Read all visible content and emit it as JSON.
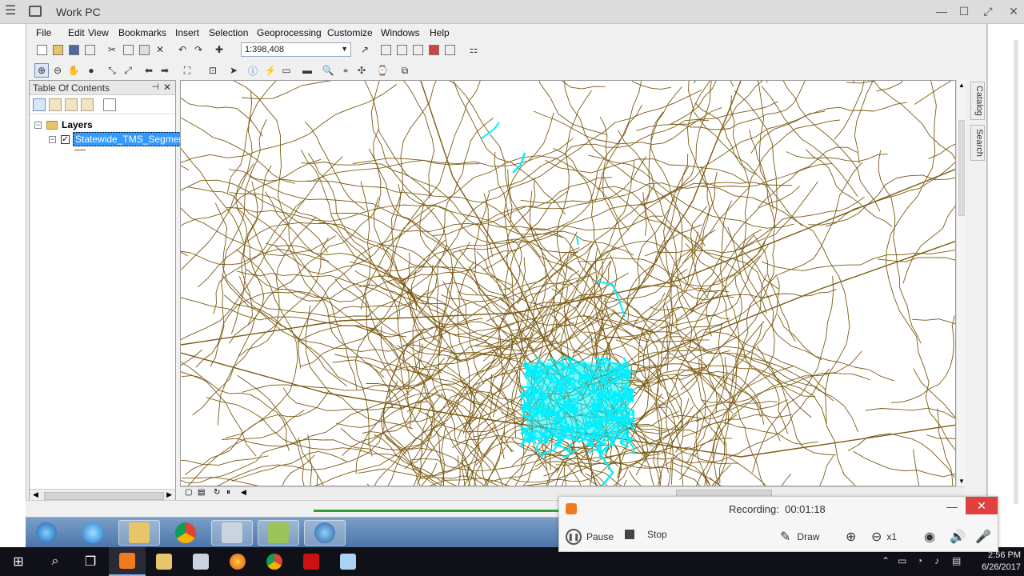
{
  "window": {
    "title": "Work PC"
  },
  "menu": [
    "File",
    "Edit",
    "View",
    "Bookmarks",
    "Insert",
    "Selection",
    "Geoprocessing",
    "Customize",
    "Windows",
    "Help"
  ],
  "toolbar": {
    "scale": "1:398,408"
  },
  "toc": {
    "title": "Table Of Contents",
    "root": "Layers",
    "layer": "Statewide_TMS_Segment"
  },
  "dock": {
    "catalog": "Catalog",
    "search": "Search"
  },
  "recorder": {
    "title": "Recording:",
    "time": "00:01:18",
    "pause": "Pause",
    "stop": "Stop",
    "draw": "Draw",
    "zoom": "x1"
  },
  "clock": {
    "time": "2:56 PM",
    "date": "6/26/2017"
  },
  "colors": {
    "roads": "#7a5a12",
    "highlight": "#00f0ff",
    "selection": "#3399ff"
  }
}
